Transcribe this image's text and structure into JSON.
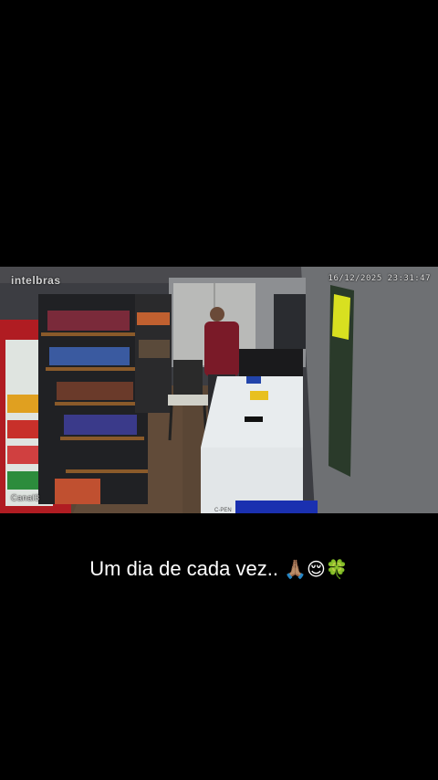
{
  "video": {
    "brand": "intelbras",
    "timestamp": "16/12/2025 23:31:47",
    "channel": "Canal3",
    "fridge_label": "C-PEN"
  },
  "caption": {
    "text": "Um dia de cada vez.. ",
    "emojis": [
      "folded-hands-icon",
      "relieved-face-icon",
      "shamrock-icon"
    ],
    "emoji_glyphs": "🙏🏽😌🍀"
  }
}
